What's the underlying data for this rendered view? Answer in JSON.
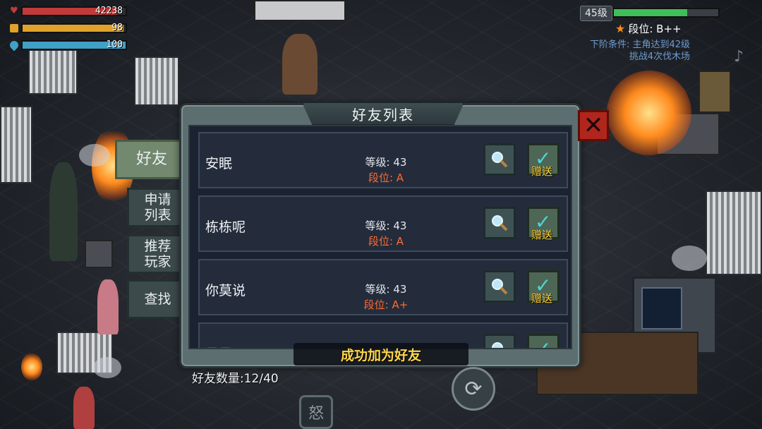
{
  "hud": {
    "hp_value": "42238",
    "hp_fill": 0.92,
    "hp_color": "#c23a3a",
    "food_value": "98",
    "food_fill": 0.98,
    "food_color": "#e0a22b",
    "water_value": "100",
    "water_fill": 1.0,
    "water_color": "#3fa0c8",
    "level": "45级",
    "xp_fill": 0.7,
    "rank": "段位: B++",
    "next_rank_condition_1": "下阶条件: 主角达到42级",
    "next_rank_condition_2": "挑战4次伐木场"
  },
  "panel": {
    "title": "好友列表",
    "close_icon": "close-x-icon",
    "tabs": [
      {
        "label": "好友",
        "active": true
      },
      {
        "label": "申请\n列表",
        "active": false
      },
      {
        "label": "推荐\n玩家",
        "active": false
      },
      {
        "label": "查找",
        "active": false
      }
    ],
    "friends": [
      {
        "name": "安眠",
        "level": "等级: 43",
        "rank": "段位: A",
        "gift_label": "赠送"
      },
      {
        "name": "栋栋呢",
        "level": "等级: 43",
        "rank": "段位: A",
        "gift_label": "赠送"
      },
      {
        "name": "你莫说",
        "level": "等级: 43",
        "rank": "段位: A+",
        "gift_label": "赠送"
      },
      {
        "name": "昊昊"
      }
    ],
    "toast": "成功加为好友",
    "friend_count": "好友数量:12/40"
  },
  "controls": {
    "emote_glyph": "怒"
  }
}
